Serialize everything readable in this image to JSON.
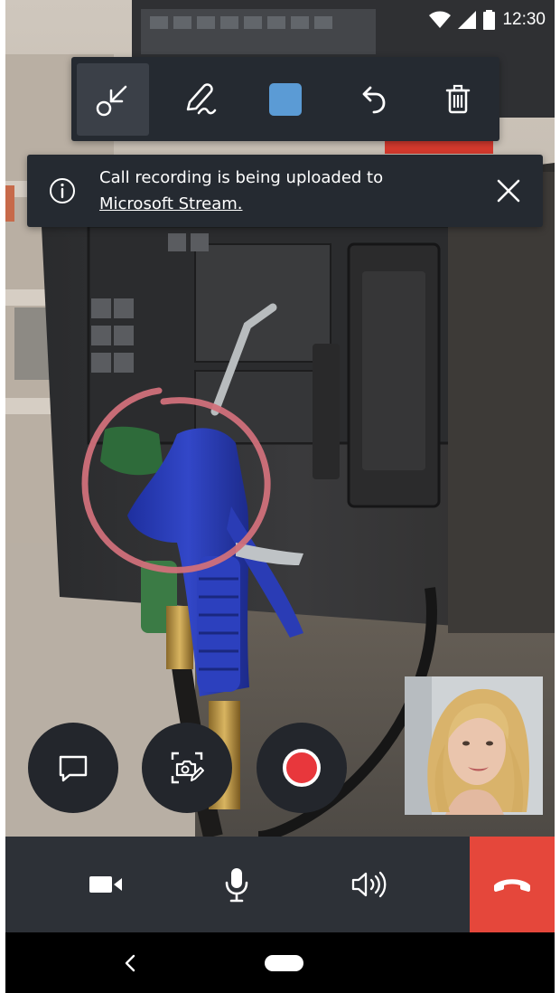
{
  "status_bar": {
    "time": "12:30",
    "icons": [
      "wifi-icon",
      "cell-signal-icon",
      "battery-icon"
    ]
  },
  "toolbar": {
    "tools": [
      {
        "name": "arrow-tool",
        "icon": "arrow-pointer-icon",
        "active": true
      },
      {
        "name": "ink-tool",
        "icon": "pen-icon",
        "active": false
      },
      {
        "name": "color-picker",
        "icon": "color-swatch",
        "active": false
      },
      {
        "name": "undo-tool",
        "icon": "undo-icon",
        "active": false
      },
      {
        "name": "delete-tool",
        "icon": "trash-icon",
        "active": false
      }
    ],
    "selected_color": "#5b9bd5"
  },
  "banner": {
    "message": "Call recording is being uploaded to",
    "link_text": "Microsoft Stream."
  },
  "actions": [
    {
      "name": "chat-button",
      "icon": "chat-bubble-icon"
    },
    {
      "name": "snapshot-button",
      "icon": "camera-annotate-icon"
    },
    {
      "name": "record-button",
      "icon": "record-icon"
    }
  ],
  "call_controls": [
    {
      "name": "video-toggle",
      "icon": "video-camera-icon"
    },
    {
      "name": "mic-toggle",
      "icon": "microphone-icon"
    },
    {
      "name": "speaker-toggle",
      "icon": "speaker-icon"
    },
    {
      "name": "hang-up",
      "icon": "phone-hangup-icon",
      "color": "#e5473b"
    }
  ],
  "colors": {
    "annotation_ink": "#d0707a",
    "record": "#e8373c",
    "hangup": "#e5473b",
    "panel": "#252a31"
  },
  "nav": {
    "icons": [
      "back-icon",
      "home-pill"
    ]
  }
}
